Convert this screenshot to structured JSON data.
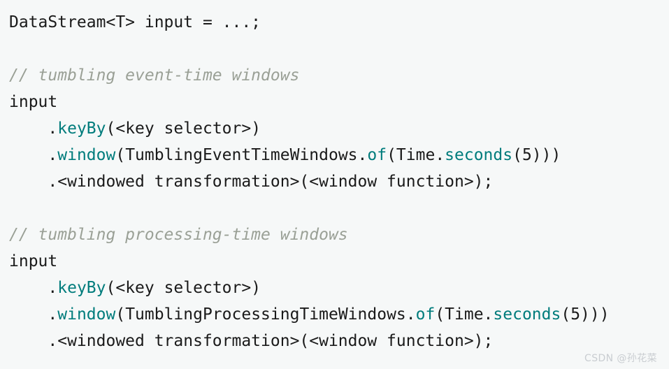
{
  "code_block": {
    "language": "java",
    "background_color": "#f6f8f8",
    "default_text_color": "#1a1a1a",
    "method_color": "#007c7c",
    "comment_color": "#9aa096",
    "lines": [
      {
        "index": 0,
        "text": "DataStream<T> input = ...;",
        "tokens": [
          {
            "t": "DataStream<T> input = ...;",
            "k": "plain"
          }
        ]
      },
      {
        "index": 1,
        "text": "",
        "tokens": []
      },
      {
        "index": 2,
        "text": "// tumbling event-time windows",
        "tokens": [
          {
            "t": "// tumbling event-time windows",
            "k": "comment"
          }
        ]
      },
      {
        "index": 3,
        "text": "input",
        "tokens": [
          {
            "t": "input",
            "k": "plain"
          }
        ]
      },
      {
        "index": 4,
        "text": "    .keyBy(<key selector>)",
        "tokens": [
          {
            "t": "    .",
            "k": "plain"
          },
          {
            "t": "keyBy",
            "k": "method"
          },
          {
            "t": "(<key selector>)",
            "k": "plain"
          }
        ]
      },
      {
        "index": 5,
        "text": "    .window(TumblingEventTimeWindows.of(Time.seconds(5)))",
        "tokens": [
          {
            "t": "    .",
            "k": "plain"
          },
          {
            "t": "window",
            "k": "method"
          },
          {
            "t": "(TumblingEventTimeWindows.",
            "k": "plain"
          },
          {
            "t": "of",
            "k": "method"
          },
          {
            "t": "(Time.",
            "k": "plain"
          },
          {
            "t": "seconds",
            "k": "method"
          },
          {
            "t": "(5)))",
            "k": "plain"
          }
        ]
      },
      {
        "index": 6,
        "text": "    .<windowed transformation>(<window function>);",
        "tokens": [
          {
            "t": "    .<windowed transformation>(<window function>);",
            "k": "plain"
          }
        ]
      },
      {
        "index": 7,
        "text": "",
        "tokens": []
      },
      {
        "index": 8,
        "text": "// tumbling processing-time windows",
        "tokens": [
          {
            "t": "// tumbling processing-time windows",
            "k": "comment"
          }
        ]
      },
      {
        "index": 9,
        "text": "input",
        "tokens": [
          {
            "t": "input",
            "k": "plain"
          }
        ]
      },
      {
        "index": 10,
        "text": "    .keyBy(<key selector>)",
        "tokens": [
          {
            "t": "    .",
            "k": "plain"
          },
          {
            "t": "keyBy",
            "k": "method"
          },
          {
            "t": "(<key selector>)",
            "k": "plain"
          }
        ]
      },
      {
        "index": 11,
        "text": "    .window(TumblingProcessingTimeWindows.of(Time.seconds(5)))",
        "tokens": [
          {
            "t": "    .",
            "k": "plain"
          },
          {
            "t": "window",
            "k": "method"
          },
          {
            "t": "(TumblingProcessingTimeWindows.",
            "k": "plain"
          },
          {
            "t": "of",
            "k": "method"
          },
          {
            "t": "(Time.",
            "k": "plain"
          },
          {
            "t": "seconds",
            "k": "method"
          },
          {
            "t": "(5)))",
            "k": "plain"
          }
        ]
      },
      {
        "index": 12,
        "text": "    .<windowed transformation>(<window function>);",
        "tokens": [
          {
            "t": "    .<windowed transformation>(<window function>);",
            "k": "plain"
          }
        ]
      }
    ]
  },
  "watermark": {
    "text": "CSDN @孙花菜",
    "color": "#c9cdd1"
  }
}
